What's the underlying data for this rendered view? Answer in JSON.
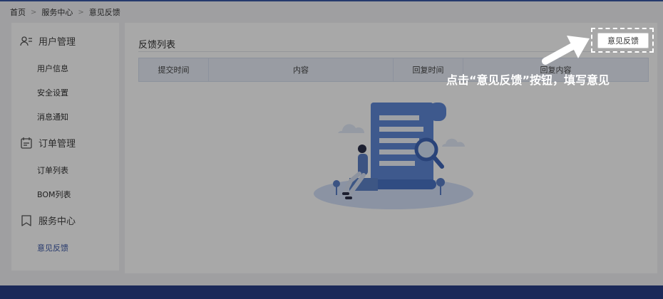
{
  "breadcrumb": {
    "items": [
      "首页",
      "服务中心",
      "意见反馈"
    ]
  },
  "sidebar": {
    "groups": [
      {
        "label": "用户管理",
        "icon": "user-list-icon",
        "items": [
          "用户信息",
          "安全设置",
          "消息通知"
        ]
      },
      {
        "label": "订单管理",
        "icon": "order-calendar-icon",
        "items": [
          "订单列表",
          "BOM列表"
        ]
      },
      {
        "label": "服务中心",
        "icon": "bookmark-icon",
        "items": [
          "意见反馈"
        ]
      }
    ],
    "active_item": "意见反馈"
  },
  "main": {
    "title": "反馈列表",
    "button_label": "意见反馈",
    "columns": [
      "提交时间",
      "内容",
      "回复时间",
      "回复内容"
    ]
  },
  "annotation": {
    "text": "点击“意见反馈”按钮，填写意见"
  },
  "colors": {
    "accent": "#3a57a6",
    "footer": "#2a3f87",
    "table_header_bg": "#e8edf8"
  }
}
